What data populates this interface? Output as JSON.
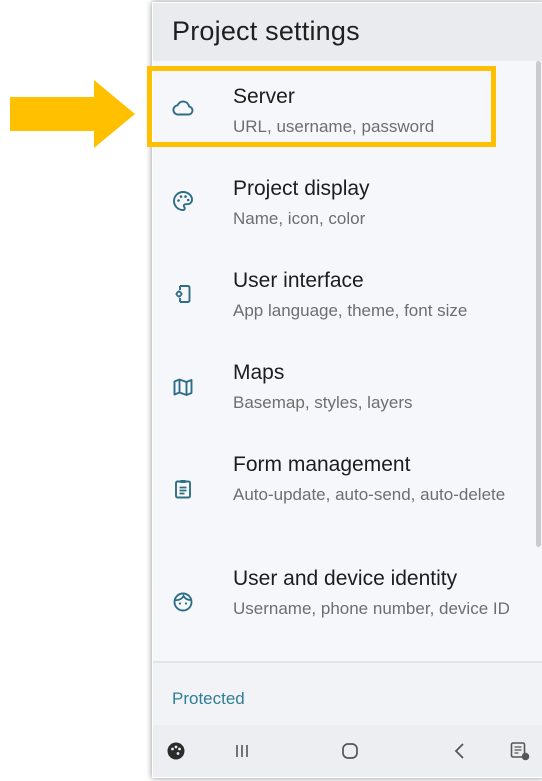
{
  "app_bar": {
    "title": "Project settings"
  },
  "settings": [
    {
      "title": "Server",
      "subtitle": "URL, username, password",
      "icon": "cloud-icon"
    },
    {
      "title": "Project display",
      "subtitle": "Name, icon, color",
      "icon": "palette-icon"
    },
    {
      "title": "User interface",
      "subtitle": "App language, theme, font size",
      "icon": "phone-settings-icon"
    },
    {
      "title": "Maps",
      "subtitle": "Basemap, styles, layers",
      "icon": "map-icon"
    },
    {
      "title": "Form management",
      "subtitle": "Auto-update, auto-send, auto-delete",
      "icon": "clipboard-icon"
    },
    {
      "title": "User and device identity",
      "subtitle": "Username, phone number, device ID",
      "icon": "face-icon"
    }
  ],
  "sections": {
    "protected": "Protected"
  },
  "nav_bar": {
    "buttons": [
      "keyboard-palette-icon",
      "recent-apps-icon",
      "home-icon",
      "back-icon",
      "keyboard-switch-icon"
    ]
  },
  "annotation": {
    "highlight_color": "#ffc000",
    "arrow_color": "#ffc000",
    "target": "Server"
  },
  "colors": {
    "accent": "#2f7e9a",
    "icon": "#2d6e86",
    "title_text": "#1d1d1d",
    "subtitle_text": "#6e6e6e"
  }
}
